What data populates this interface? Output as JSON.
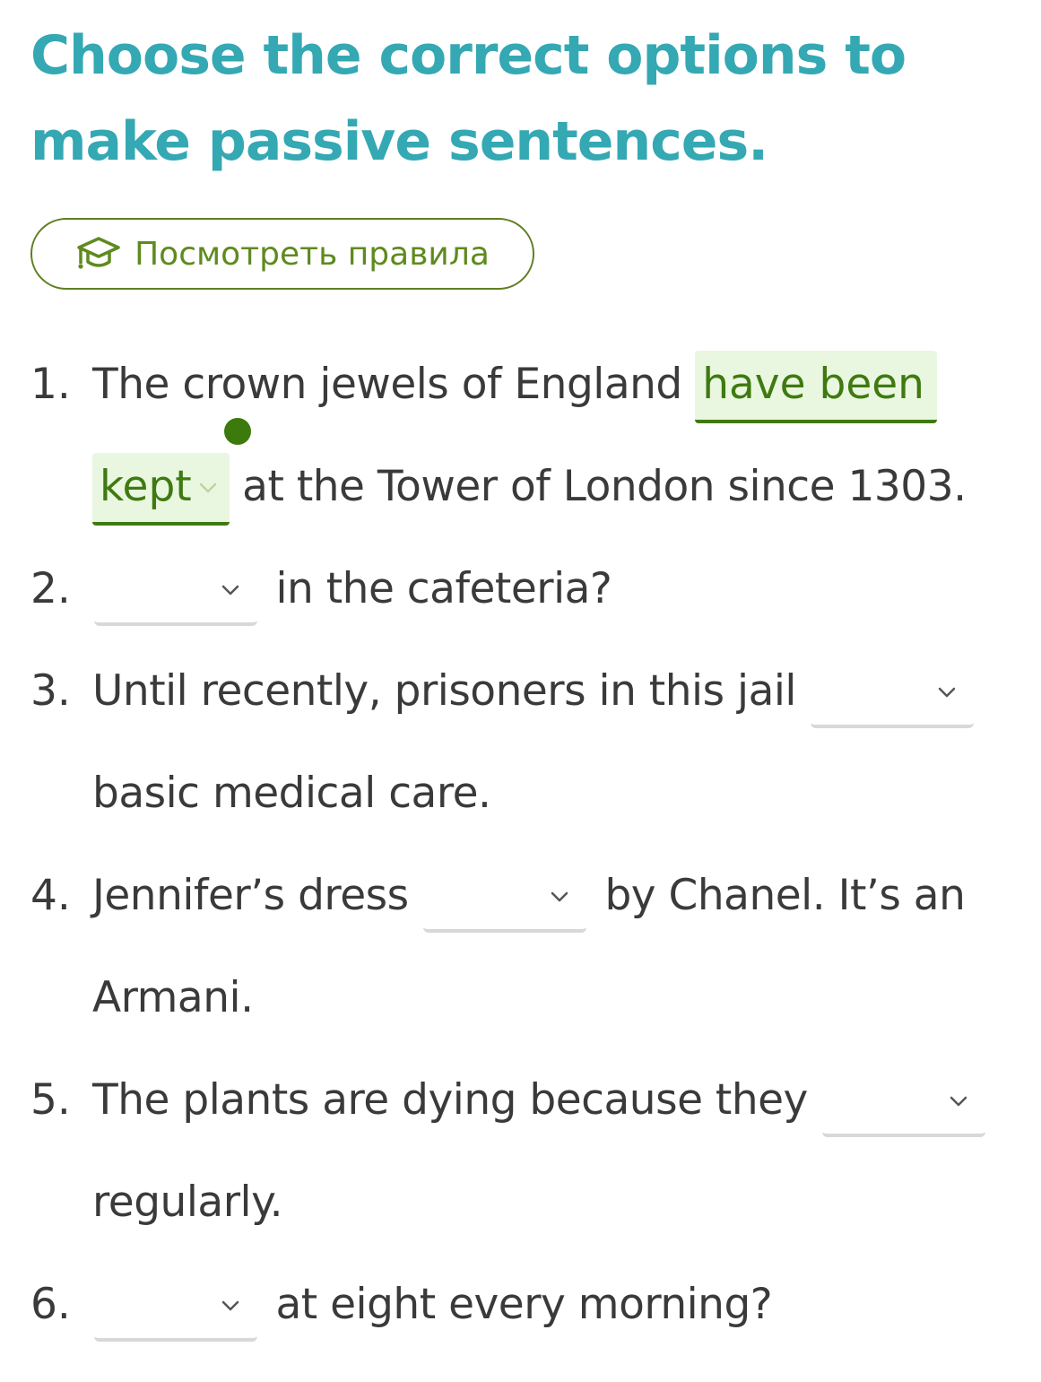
{
  "title": "Choose the correct options to make passive sentences.",
  "rules_button": {
    "label": "Посмотреть правила",
    "icon": "graduation-cap-icon"
  },
  "colors": {
    "title": "#34a8b3",
    "button": "#5f8a1f",
    "answer_text": "#3f7a10",
    "answer_bg": "#eaf7e0",
    "gap_underline": "#d8d8d8"
  },
  "items": [
    {
      "num": "1.",
      "before": "The crown jewels of England ",
      "answer": "have been kept",
      "after": " at the Tower of London since 1303.",
      "status": "correct"
    },
    {
      "num": "2.",
      "before": "",
      "answer": "",
      "after": " in the cafeteria?"
    },
    {
      "num": "3.",
      "before": "Until recently, prisoners in this jail ",
      "answer": "",
      "after": " basic medical care."
    },
    {
      "num": "4.",
      "before": "Jennifer’s dress ",
      "answer": "",
      "after": " by Chanel. It’s an Armani."
    },
    {
      "num": "5.",
      "before": "The plants are dying because they ",
      "answer": "",
      "after": " regularly."
    },
    {
      "num": "6.",
      "before": "",
      "answer": "",
      "after": " at eight every morning?"
    }
  ]
}
